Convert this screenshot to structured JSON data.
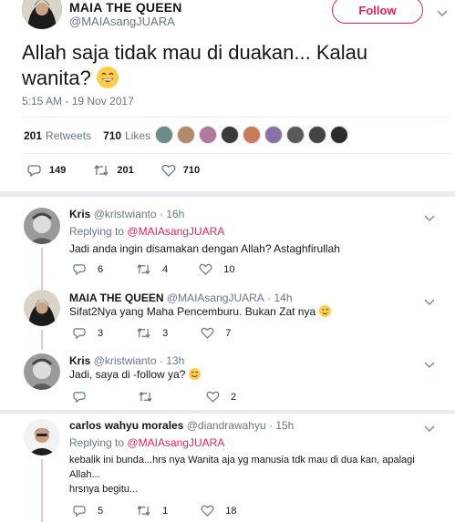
{
  "main": {
    "name": "MAIA THE QUEEN",
    "handle": "@MAIAsangJUARA",
    "follow_label": "Follow",
    "text": "Allah saja tidak mau di duakan... Kalau wanita?",
    "time": "5:15 AM - 19 Nov 2017",
    "retweets_count": "201",
    "retweets_label": "Retweets",
    "likes_count": "710",
    "likes_label": "Likes",
    "actions": {
      "reply": "149",
      "retweet": "201",
      "like": "710"
    }
  },
  "replies": [
    {
      "name": "Kris",
      "handle": "@kristwianto",
      "time": "16h",
      "replying_prefix": "Replying to",
      "replying_to": "@MAIAsangJUARA",
      "text": "Jadi anda ingin disamakan dengan Allah?  Astaghfirullah",
      "reply": "6",
      "retweet": "4",
      "like": "10"
    },
    {
      "name": "MAIA THE QUEEN",
      "handle": "@MAIAsangJUARA",
      "time": "14h",
      "text": "Sifat2Nya yang Maha Pencemburu. Bukan Zat nya",
      "reply": "3",
      "retweet": "3",
      "like": "7"
    },
    {
      "name": "Kris",
      "handle": "@kristwianto",
      "time": "13h",
      "text": "Jadi, saya di -follow ya?",
      "reply": "",
      "retweet": "",
      "like": "2"
    },
    {
      "name": "carlos wahyu morales",
      "handle": "@diandrawahyu",
      "time": "15h",
      "replying_prefix": "Replying to",
      "replying_to": "@MAIAsangJUARA",
      "text_line1": "kebalik ini bunda...hrs nya Wanita aja yg manusia tdk mau di dua kan, apalagi",
      "text_line2": "Allah...",
      "text_line3": "hrsnya begitu...",
      "reply": "5",
      "retweet": "1",
      "like": "18"
    }
  ],
  "colors": {
    "accent": "#e0245e",
    "muted": "#657786",
    "text": "#14171a",
    "thread": "#f4c1cf"
  }
}
